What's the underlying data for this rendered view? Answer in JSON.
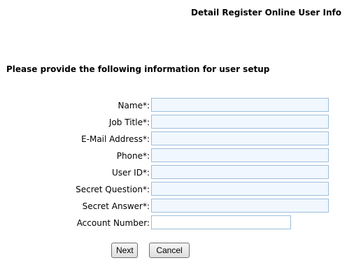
{
  "header": {
    "title": "Detail Register Online User Info"
  },
  "form": {
    "instructions": "Please provide the following information for user setup",
    "fields": [
      {
        "label": "Name*:",
        "value": ""
      },
      {
        "label": "Job Title*:",
        "value": ""
      },
      {
        "label": "E-Mail Address*:",
        "value": ""
      },
      {
        "label": "Phone*:",
        "value": ""
      },
      {
        "label": "User ID*:",
        "value": ""
      },
      {
        "label": "Secret Question*:",
        "value": ""
      },
      {
        "label": "Secret Answer*:",
        "value": ""
      },
      {
        "label": "Account Number:",
        "value": ""
      }
    ]
  },
  "buttons": {
    "next": "Next",
    "cancel": "Cancel"
  },
  "colors": {
    "input_border": "#9dbedc",
    "input_background": "#f0f7ff"
  }
}
